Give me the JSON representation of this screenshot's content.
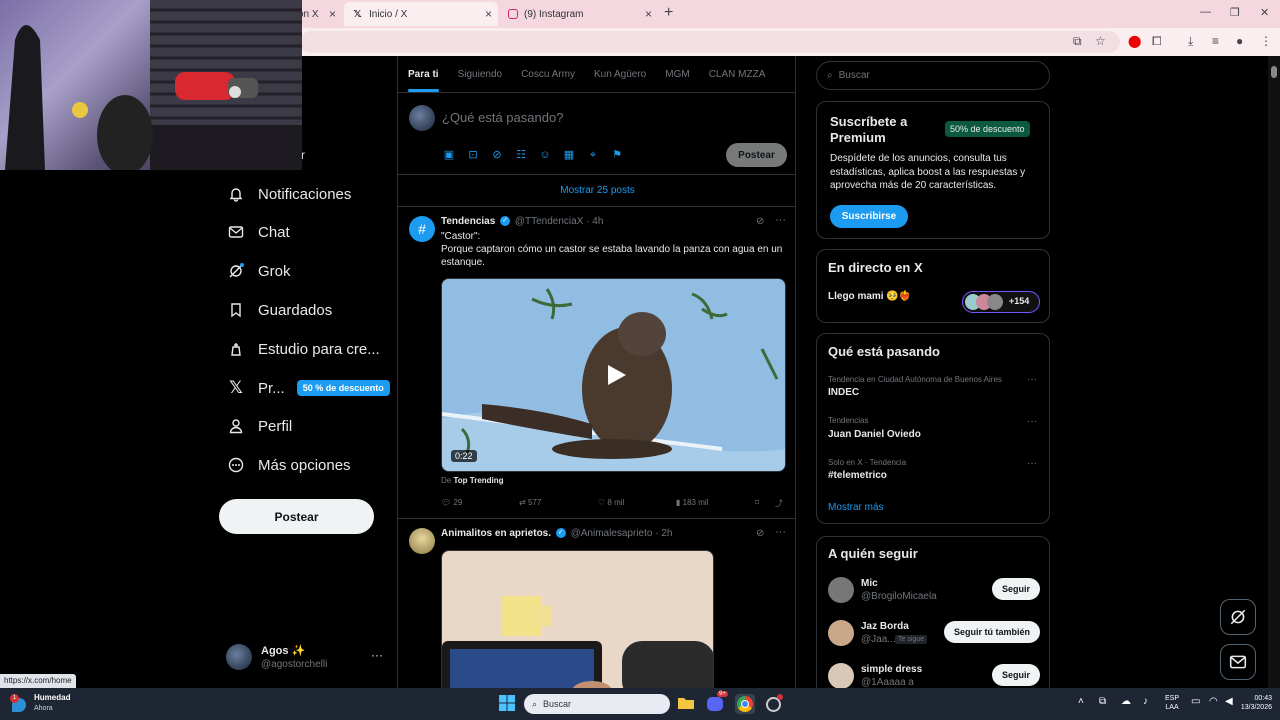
{
  "browser": {
    "tabs": [
      {
        "label": "on X",
        "icon": "x-icon",
        "active": false
      },
      {
        "label": "Inicio / X",
        "icon": "x-icon",
        "active": true
      },
      {
        "label": "(9) Instagram",
        "icon": "instagram-icon",
        "active": false
      }
    ],
    "status_url": "https://x.com/home"
  },
  "nav": {
    "partial_label": "r",
    "items": [
      {
        "label": "Notificaciones",
        "icon": "bell-icon"
      },
      {
        "label": "Chat",
        "icon": "mail-icon"
      },
      {
        "label": "Grok",
        "icon": "grok-icon"
      },
      {
        "label": "Guardados",
        "icon": "bookmark-icon"
      },
      {
        "label": "Estudio para cre...",
        "icon": "creator-studio-icon"
      },
      {
        "label": "Pr...",
        "icon": "x-logo-icon",
        "badge": "50 % de descuento"
      },
      {
        "label": "Perfil",
        "icon": "person-icon"
      },
      {
        "label": "Más opciones",
        "icon": "more-circle-icon"
      }
    ],
    "post_button": "Postear",
    "account": {
      "name": "Agos ✨",
      "handle": "@agostorchelli"
    }
  },
  "feed": {
    "tabs": [
      "Para ti",
      "Siguiendo",
      "Coscu Army",
      "Kun Agüero",
      "MGM",
      "CLAN MZZA"
    ],
    "composer_placeholder": "¿Qué está pasando?",
    "composer_post": "Postear",
    "show_posts": "Mostrar 25 posts",
    "tweets": [
      {
        "name": "Tendencias",
        "handle": "@TTendenciaX",
        "time": "· 4h",
        "text_line1": "\"Castor\":",
        "text_line2": "Porque captaron cómo un castor se estaba lavando la panza con agua en un estanque.",
        "video_duration": "0:22",
        "source_prefix": "De",
        "source": "Top Trending",
        "replies": "29",
        "reposts": "577",
        "likes": "8 mil",
        "views": "183 mil"
      },
      {
        "name": "Animalitos en aprietos.",
        "handle": "@Animalesaprieto",
        "time": "· 2h"
      }
    ]
  },
  "sidebar": {
    "search_placeholder": "Buscar",
    "premium": {
      "title": "Suscríbete a Premium",
      "badge": "50% de descuento",
      "description": "Despídete de los anuncios, consulta tus estadísticas, aplica boost a las respuestas y aprovecha más de 20 características.",
      "button": "Suscribirse"
    },
    "live": {
      "title": "En directo en X",
      "item": "Llego mami 🥺❤️‍🔥",
      "count": "+154"
    },
    "trends": {
      "title": "Qué está pasando",
      "items": [
        {
          "meta": "Tendencia en Ciudad Autónoma de Buenos Aires",
          "title": "INDEC"
        },
        {
          "meta": "Tendencias",
          "title": "Juan Daniel Oviedo"
        },
        {
          "meta": "Solo en X · Tendencia",
          "title": "#telemetrico"
        }
      ],
      "show_more": "Mostrar más"
    },
    "follow": {
      "title": "A quién seguir",
      "items": [
        {
          "name": "Mic",
          "handle": "@BrogiloMicaela",
          "button": "Seguir",
          "follows_you": ""
        },
        {
          "name": "Jaz Borda",
          "handle": "@Jaa...",
          "button": "Seguir tú también",
          "follows_you": "Te sigue"
        },
        {
          "name": "simple dress",
          "handle": "@1Aaaaa a",
          "button": "Seguir",
          "follows_you": ""
        }
      ]
    }
  },
  "taskbar": {
    "weather_title": "Humedad",
    "weather_sub": "Ahora",
    "weather_badge": "1",
    "search_placeholder": "Buscar",
    "lang_top": "ESP",
    "lang_bottom": "LAA",
    "time": "00:43",
    "date": "13/3/2026",
    "discord_badge": "9+"
  },
  "colors": {
    "accent": "#1d9bf0",
    "background": "#000000",
    "border": "#2f3336",
    "muted": "#71767b",
    "premium_badge": "#00ba7c"
  }
}
